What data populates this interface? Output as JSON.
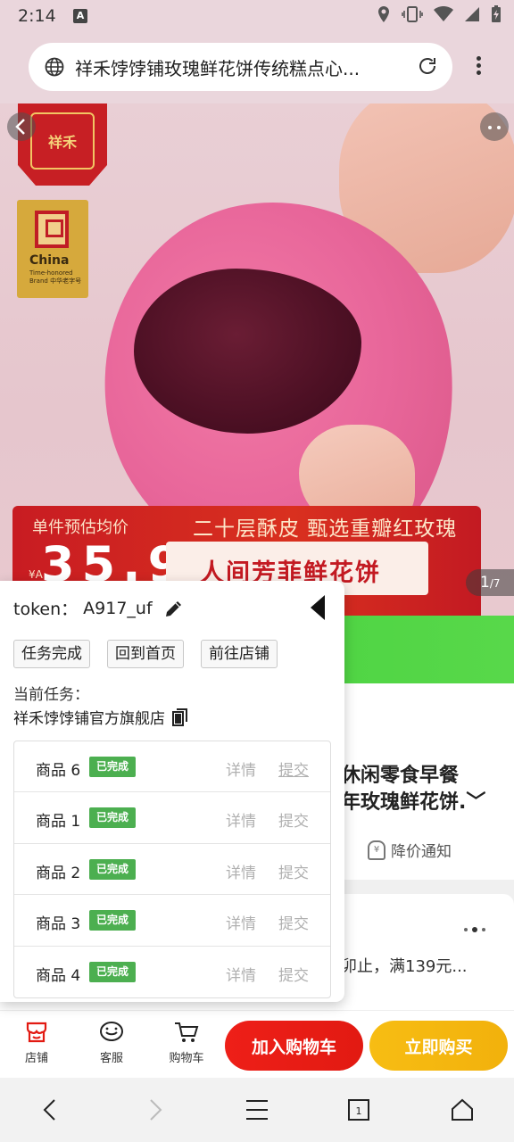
{
  "status_bar": {
    "time": "2:14",
    "a_icon": "A"
  },
  "browser": {
    "url_title": "祥禾饽饽铺玫瑰鲜花饼传统糕点心..."
  },
  "hero": {
    "logo_char": "祥禾",
    "brand_badge_name": "China",
    "brand_badge_sub": "Time-honored Brand 中华老字号",
    "banner_left_label": "单件预估均价",
    "banner_right_label": "二十层酥皮 甄选重瓣红玫瑰",
    "banner_price": "35.9",
    "banner_yen": "¥A",
    "banner_slogan": "人间芳菲鲜花饼",
    "counter_current": "1",
    "counter_total": "/7"
  },
  "product": {
    "title_line1": "休闲零食早餐",
    "title_line2": "年玫瑰鲜花饼.﹀",
    "notify_label": "降价通知",
    "notify_icon": "¥",
    "promo_text": "卯止，满139元..."
  },
  "action_bar": {
    "shop_label": "店铺",
    "service_label": "客服",
    "cart_label": "购物车",
    "add_cart": "加入购物车",
    "buy_now": "立即购买"
  },
  "overlay": {
    "token_label": "token：",
    "token_value": "A917_uf",
    "btn_done": "任务完成",
    "btn_home": "回到首页",
    "btn_shop": "前往店铺",
    "task_label": "当前任务：",
    "task_name": "祥禾饽饽铺官方旗舰店",
    "goods": [
      {
        "name": "商品 6",
        "status": "已完成",
        "detail": "详情",
        "submit": "提交"
      },
      {
        "name": "商品 1",
        "status": "已完成",
        "detail": "详情",
        "submit": "提交"
      },
      {
        "name": "商品 2",
        "status": "已完成",
        "detail": "详情",
        "submit": "提交"
      },
      {
        "name": "商品 3",
        "status": "已完成",
        "detail": "详情",
        "submit": "提交"
      },
      {
        "name": "商品 4",
        "status": "已完成",
        "detail": "详情",
        "submit": "提交"
      }
    ]
  },
  "colors": {
    "accent_red": "#e21a12",
    "accent_yellow": "#f2b10c",
    "done_green": "#4caf50",
    "strip_green": "#41cf3a"
  }
}
